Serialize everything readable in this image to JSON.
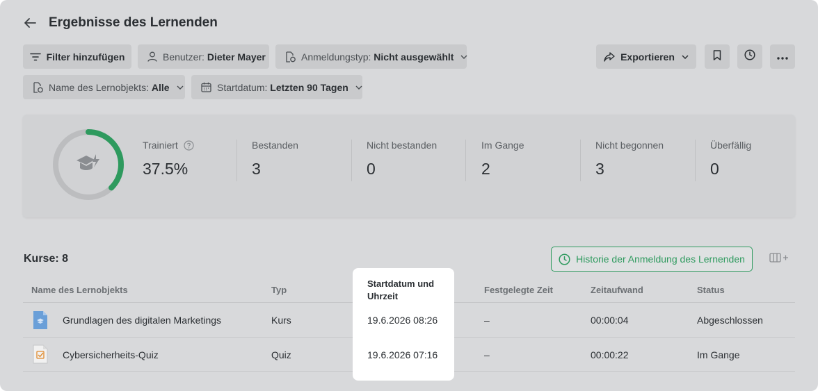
{
  "header": {
    "title": "Ergebnisse des Lernenden"
  },
  "filters": {
    "add_filter": "Filter hinzufügen",
    "user_label": "Benutzer:",
    "user_value": "Dieter Mayer",
    "registration_label": "Anmeldungstyp:",
    "registration_value": "Nicht ausgewählt",
    "object_label": "Name des Lernobjekts:",
    "object_value": "Alle",
    "start_label": "Startdatum:",
    "start_value": "Letzten 90 Tagen"
  },
  "toolbar": {
    "export_label": "Exportieren"
  },
  "stats": {
    "trained_label": "Trainiert",
    "trained_value": "37.5%",
    "trained_fraction": 0.375,
    "items": [
      {
        "label": "Bestanden",
        "value": "3"
      },
      {
        "label": "Nicht bestanden",
        "value": "0"
      },
      {
        "label": "Im Gange",
        "value": "2"
      },
      {
        "label": "Nicht begonnen",
        "value": "3"
      },
      {
        "label": "Überfällig",
        "value": "0"
      }
    ]
  },
  "table": {
    "count_label": "Kurse: 8",
    "history_button": "Historie der Anmeldung des Lernenden",
    "columns": {
      "name": "Name des Lernobjekts",
      "type": "Typ",
      "start": "Startdatum und Uhrzeit",
      "fixed": "Festgelegte Zeit",
      "effort": "Zeitaufwand",
      "status": "Status"
    },
    "rows": [
      {
        "icon": "course-file-icon",
        "name": "Grundlagen des digitalen Marketings",
        "type": "Kurs",
        "start": "19.6.2026 08:26",
        "fixed": "–",
        "effort": "00:00:04",
        "status": "Abgeschlossen"
      },
      {
        "icon": "quiz-file-icon",
        "name": "Cybersicherheits-Quiz",
        "type": "Quiz",
        "start": "19.6.2026 07:16",
        "fixed": "–",
        "effort": "00:00:22",
        "status": "Im Gange"
      }
    ]
  },
  "colors": {
    "accent": "#2e9a5e",
    "course_icon": "#6a9fd8",
    "quiz_icon": "#e08a2c"
  }
}
